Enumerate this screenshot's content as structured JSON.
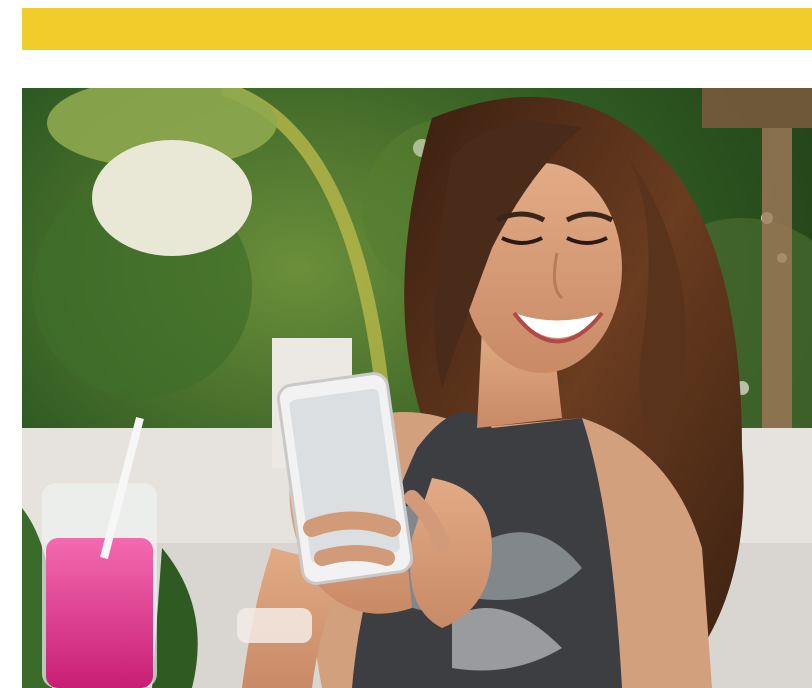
{
  "banner": {
    "color": "#f1cd2b"
  },
  "hero_image": {
    "subject": "woman-smiling-at-phone-photo",
    "colors": {
      "foliage": "#2f5a22",
      "hair": "#4a2a18",
      "skin": "#d9a07c",
      "drink": "#e6438f"
    }
  }
}
